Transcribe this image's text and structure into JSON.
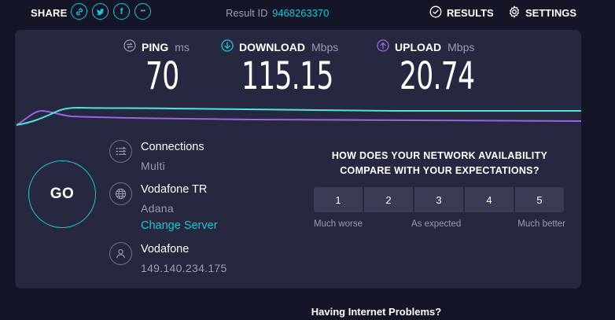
{
  "share": {
    "label": "SHARE",
    "icons": [
      {
        "name": "link-icon"
      },
      {
        "name": "twitter-icon",
        "glyph": ""
      },
      {
        "name": "facebook-icon",
        "glyph": "f"
      },
      {
        "name": "more-icon",
        "glyph": "•••"
      }
    ]
  },
  "result": {
    "label": "Result ID",
    "id": "9468263370"
  },
  "nav": {
    "results": "RESULTS",
    "settings": "SETTINGS"
  },
  "metrics": {
    "ping": {
      "label": "PING",
      "unit": "ms",
      "value": "70"
    },
    "download": {
      "label": "DOWNLOAD",
      "unit": "Mbps",
      "value": "115.15"
    },
    "upload": {
      "label": "UPLOAD",
      "unit": "Mbps",
      "value": "20.74"
    }
  },
  "colors": {
    "accent": "#1fc4d6",
    "upload": "#9b63e8",
    "panel": "#26283f",
    "background": "#141526"
  },
  "go": {
    "label": "GO"
  },
  "connections": {
    "title": "Connections",
    "value": "Multi"
  },
  "server": {
    "name": "Vodafone TR",
    "location": "Adana",
    "change": "Change Server"
  },
  "isp": {
    "name": "Vodafone",
    "ip": "149.140.234.175"
  },
  "survey": {
    "question_line1": "HOW DOES YOUR NETWORK AVAILABILITY",
    "question_line2": "COMPARE WITH YOUR EXPECTATIONS?",
    "options": [
      "1",
      "2",
      "3",
      "4",
      "5"
    ],
    "low_label": "Much worse",
    "mid_label": "As expected",
    "high_label": "Much better"
  },
  "footer": {
    "problems": "Having Internet Problems?"
  }
}
